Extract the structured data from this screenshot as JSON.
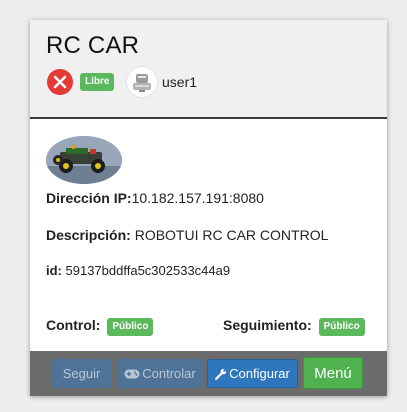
{
  "card": {
    "title": "RC CAR",
    "status_badge": "Libre",
    "owner": "user1",
    "robot_image_alt": "RC car robot photo",
    "ip_label": "Dirección IP:",
    "ip_value": "10.182.157.191:8080",
    "description_label": "Descripción:",
    "description_value": "ROBOTUI RC CAR CONTROL",
    "id_label": "id:",
    "id_value": "59137bddffa5c302533c44a9",
    "control_label": "Control:",
    "control_badge": "Público",
    "follow_label": "Seguimiento:",
    "follow_badge": "Público"
  },
  "footer": {
    "follow_button": "Seguir",
    "control_button": "Controlar",
    "configure_button": "Configurar",
    "menu_button": "Menú"
  },
  "icons": {
    "close": "close-icon",
    "avatar": "robot-avatar-icon",
    "control": "gamepad-icon",
    "configure": "wrench-icon"
  },
  "colors": {
    "badge_green": "#5cb85c",
    "close_red": "#e53935",
    "primary_blue": "#2f77bc",
    "menu_green": "#4fb24f",
    "footer_gray": "#6b6b6b"
  }
}
